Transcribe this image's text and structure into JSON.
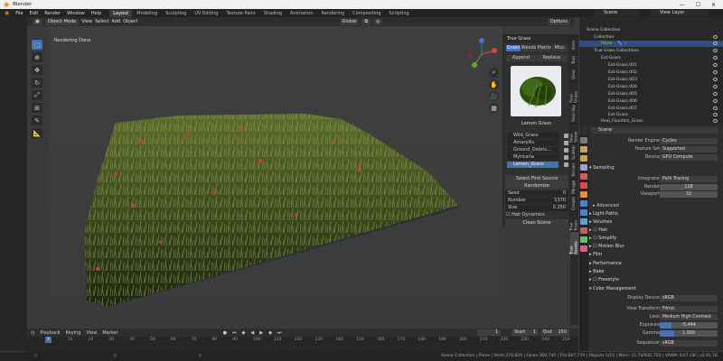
{
  "window": {
    "title": "Blender",
    "minimize": "—",
    "maximize": "☐",
    "close": "✕"
  },
  "menu": [
    "File",
    "Edit",
    "Render",
    "Window",
    "Help"
  ],
  "workspaces": [
    {
      "label": "Layout",
      "active": true
    },
    {
      "label": "Modeling"
    },
    {
      "label": "Sculpting"
    },
    {
      "label": "UV Editing"
    },
    {
      "label": "Texture Paint"
    },
    {
      "label": "Shading"
    },
    {
      "label": "Animation"
    },
    {
      "label": "Rendering"
    },
    {
      "label": "Compositing"
    },
    {
      "label": "Scripting"
    }
  ],
  "scene_selector": "Scene",
  "view_layer_selector": "View Layer",
  "viewport_header": {
    "mode": "Object Mode",
    "menus": [
      "View",
      "Select",
      "Add",
      "Object"
    ],
    "orientation": "Global",
    "options": "Options"
  },
  "viewport": {
    "status": "Rendering Done"
  },
  "true_grass": {
    "title": "True Grass",
    "tabs": [
      {
        "label": "Grass",
        "active": true
      },
      {
        "label": "Weeds"
      },
      {
        "label": "Plants"
      },
      {
        "label": "Misc"
      }
    ],
    "append": "Append",
    "replace": "Replace",
    "preview_label": "Lemon Grass",
    "assets": [
      {
        "label": "Wild_Grass"
      },
      {
        "label": "Amaryllis"
      },
      {
        "label": "Ground_Debris..."
      },
      {
        "label": "Myricaria"
      },
      {
        "label": "Lemon_Grass",
        "selected": true
      }
    ],
    "select_source": "Select First Source",
    "randomize": "Randomize",
    "fields": [
      {
        "label": "Seed",
        "value": "0"
      },
      {
        "label": "Number",
        "value": "5370"
      },
      {
        "label": "Size",
        "value": "0.250"
      }
    ],
    "hair_dynamics": "Hair Dynamics",
    "clean_scene": "Clean Scene"
  },
  "side_tabs": [
    "Item",
    "Tool",
    "View",
    "Real Grass",
    "Real Sky",
    "Real Snow",
    "Scatter",
    "Terrain",
    "Mirage",
    "Create",
    "True Trees",
    "True Assets"
  ],
  "outliner": {
    "rows": [
      {
        "label": "Scene Collection",
        "indent": 0
      },
      {
        "label": "Collection",
        "indent": 1
      },
      {
        "label": "Plane",
        "indent": 2,
        "selected": true
      },
      {
        "label": "True Grass Collections",
        "indent": 1
      },
      {
        "label": "Ext-Grass",
        "indent": 2
      },
      {
        "label": "Ext-Grass.001",
        "indent": 3
      },
      {
        "label": "Ext-Grass.002",
        "indent": 3
      },
      {
        "label": "Ext-Grass.003",
        "indent": 3
      },
      {
        "label": "Ext-Grass.004",
        "indent": 3
      },
      {
        "label": "Ext-Grass.005",
        "indent": 3
      },
      {
        "label": "Ext-Grass.006",
        "indent": 3
      },
      {
        "label": "Ext-Grass.007",
        "indent": 3
      },
      {
        "label": "Ext-Grass",
        "indent": 3
      },
      {
        "label": "Real_Fountain_Grass",
        "indent": 2
      }
    ]
  },
  "properties": {
    "scene": "Scene",
    "render_engine": {
      "label": "Render Engine",
      "value": "Cycles"
    },
    "feature_set": {
      "label": "Feature Set",
      "value": "Supported"
    },
    "device": {
      "label": "Device",
      "value": "GPU Compute"
    },
    "sampling": "Sampling",
    "integrator": {
      "label": "Integrator",
      "value": "Path Tracing"
    },
    "render_samples": {
      "label": "Render",
      "value": "128"
    },
    "viewport_samples": {
      "label": "Viewport",
      "value": "32"
    },
    "advanced": "Advanced",
    "light_paths": "Light Paths",
    "volumes": "Volumes",
    "hair": "Hair",
    "simplify": "Simplify",
    "motion_blur": "Motion Blur",
    "film": "Film",
    "performance": "Performance",
    "bake": "Bake",
    "freestyle": "Freestyle",
    "color_management": "Color Management",
    "display_device": {
      "label": "Display Device",
      "value": "sRGB"
    },
    "view_transform": {
      "label": "View Transform",
      "value": "Filmic"
    },
    "look": {
      "label": "Look",
      "value": "Medium High Contrast"
    },
    "exposure": {
      "label": "Exposure",
      "value": "-5.444"
    },
    "gamma": {
      "label": "Gamma",
      "value": "1.000"
    },
    "sequencer": {
      "label": "Sequencer",
      "value": "sRGB"
    }
  },
  "timeline": {
    "menus": [
      "Playback",
      "Keying",
      "View",
      "Marker"
    ],
    "current_frame": "1",
    "start_label": "Start",
    "start": "1",
    "end_label": "End",
    "end": "250",
    "ticks": [
      "0",
      "10",
      "20",
      "30",
      "40",
      "50",
      "60",
      "70",
      "80",
      "90",
      "100",
      "110",
      "120",
      "130",
      "140",
      "150",
      "160",
      "170",
      "180",
      "190",
      "200",
      "210",
      "220",
      "230",
      "240",
      "250"
    ]
  },
  "status_bar": "Scene Collection | Plane | Verts:378,829 | Faces:369,740 | Tris:687,779 | Objects:1/15 | Mem: 15.74/935.750 | VRAM: 0.67 GB | v2.81.16"
}
